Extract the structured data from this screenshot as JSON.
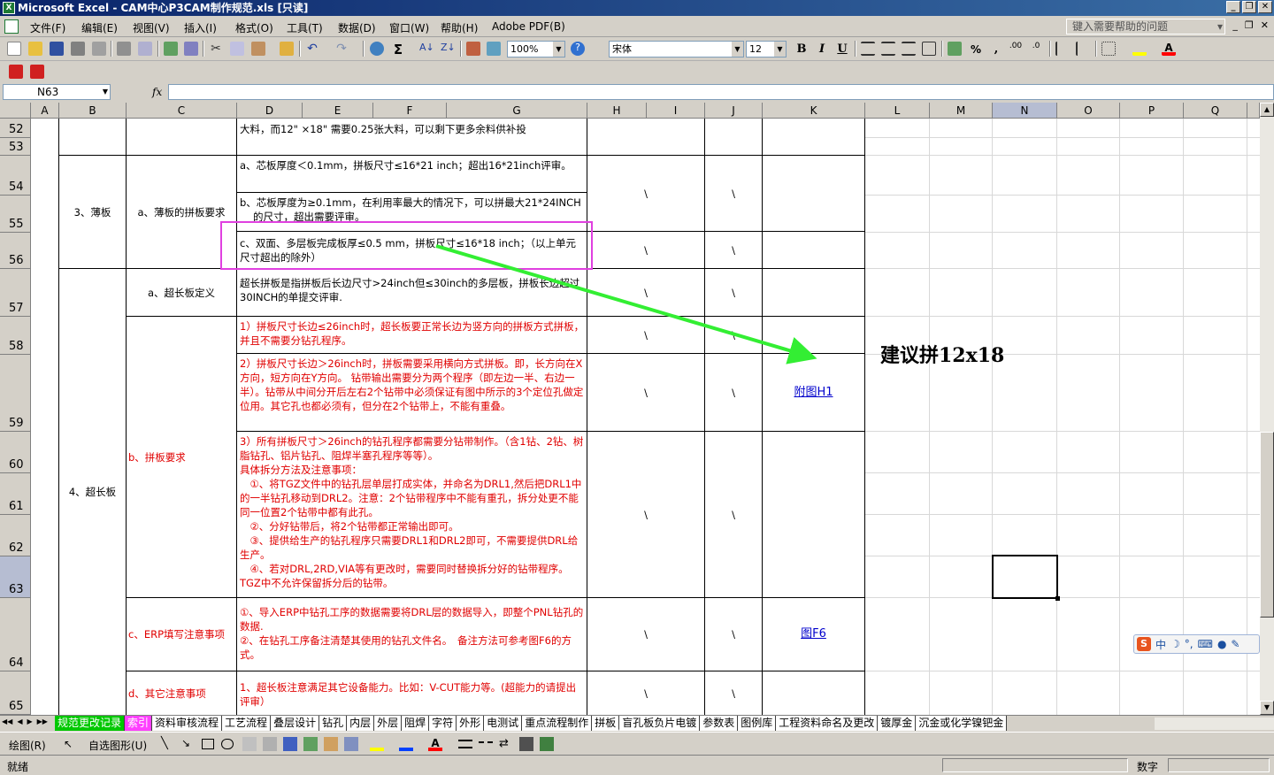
{
  "window": {
    "title": "Microsoft Excel - CAM中心P3CAM制作规范.xls [只读]"
  },
  "menu": {
    "items": [
      "文件(F)",
      "编辑(E)",
      "视图(V)",
      "插入(I)",
      "格式(O)",
      "工具(T)",
      "数据(D)",
      "窗口(W)",
      "帮助(H)",
      "Adobe PDF(B)"
    ],
    "help_placeholder": "键入需要帮助的问题"
  },
  "toolbar": {
    "zoom": "100%",
    "font": "宋体",
    "font_size": "12",
    "bold": "B",
    "italic": "I",
    "underline": "U",
    "percent": "%",
    "comma": ","
  },
  "formula": {
    "name_box": "N63",
    "fx": "fx"
  },
  "columns": [
    "A",
    "B",
    "C",
    "D",
    "E",
    "F",
    "G",
    "H",
    "I",
    "J",
    "K",
    "L",
    "M",
    "N",
    "O",
    "P",
    "Q"
  ],
  "rows": [
    "52",
    "53",
    "54",
    "55",
    "56",
    "57",
    "58",
    "59",
    "60",
    "61",
    "62",
    "63",
    "64",
    "65"
  ],
  "cells": {
    "r52_text": "大料，而12\" ×18\" 需要0.25张大料，可以剩下更多余料供补投",
    "b_thin": "3、薄板",
    "c_thin": "a、薄板的拼板要求",
    "d54": "a、芯板厚度＜0.1mm，拼板尺寸≤16*21 inch；超出16*21inch评审。",
    "d55": "b、芯板厚度为≥0.1mm，在利用率最大的情况下，可以拼最大21*24INCH的尺寸，超出需要评审。",
    "d56": "c、双面、多层板完成板厚≤0.5 mm，拼板尺寸≤16*18 inch；（以上单元尺寸超出的除外）",
    "b_long": "4、超长板",
    "c57": "a、超长板定义",
    "d57": "超长拼板是指拼板后长边尺寸>24inch但≤30inch的多层板，拼板长边超过30INCH的单提交评审.",
    "c_req": "b、拼板要求",
    "d58": "1）拼板尺寸长边≤26inch时，超长板要正常长边为竖方向的拼板方式拼板，并且不需要分钻孔程序。",
    "d59": "2）拼板尺寸长边＞26inch时，拼板需要采用横向方式拼板。即，长方向在X方向，短方向在Y方向。 钻带输出需要分为两个程序（即左边一半、右边一半）。钻带从中间分开后左右2个钻带中必须保证有图中所示的3个定位孔做定位用。其它孔也都必须有，但分在2个钻带上，不能有重叠。",
    "d60_63": "3）所有拼板尺寸＞26inch的钻孔程序都需要分钻带制作。（含1钻、2钻、树脂钻孔、铝片钻孔、阻焊半塞孔程序等等）。\n具体拆分方法及注意事项：\n　①、将TGZ文件中的钻孔层单层打成实体，并命名为DRL1,然后把DRL1中的一半钻孔移动到DRL2。注意：2个钻带程序中不能有重孔，拆分处更不能同一位置2个钻带中都有此孔。\n　②、分好钻带后，将2个钻带都正常输出即可。\n　③、提供给生产的钻孔程序只需要DRL1和DRL2即可，不需要提供DRL给生产。\n　④、若对DRL,2RD,VIA等有更改时，需要同时替换拆分好的钻带程序。TGZ中不允许保留拆分后的钻带。",
    "c64": "c、ERP填写注意事项",
    "d64": "①、导入ERP中钻孔工序的数据需要将DRL层的数据导入，即整个PNL钻孔的数据.\n②、在钻孔工序备注清楚其使用的钻孔文件名。　备注方法可参考图F6的方式。",
    "c65": "d、其它注意事项",
    "d65": "1、超长板注意满足其它设备能力。比如：V-CUT能力等。(超能力的请提出评审）",
    "slash": "\\",
    "link_h1": "附图H1",
    "link_f6": "图F6"
  },
  "annotation": "建议拼12x18",
  "sheet_tabs": [
    "规范更改记录",
    "索引",
    "资料审核流程",
    "工艺流程",
    "叠层设计",
    "钻孔",
    "内层",
    "外层",
    "阻焊",
    "字符",
    "外形",
    "电测试",
    "重点流程制作",
    "拼板",
    "盲孔板负片电镀",
    "参数表",
    "图例库",
    "工程资料命名及更改",
    "镀厚金",
    "沉金或化学镍钯金"
  ],
  "draw_toolbar": {
    "draw": "绘图(R)",
    "autoshape": "自选图形(U)"
  },
  "ime": {
    "logo": "S",
    "lang": "中"
  },
  "status": {
    "ready": "就绪",
    "num": "数字"
  },
  "colors": {
    "accent_title": "#0a246a",
    "red_text": "#e00000",
    "highlight_box": "#e040e0",
    "arrow": "#33ee33",
    "tab_green": "#00c800",
    "tab_magenta": "#ff40ff"
  }
}
